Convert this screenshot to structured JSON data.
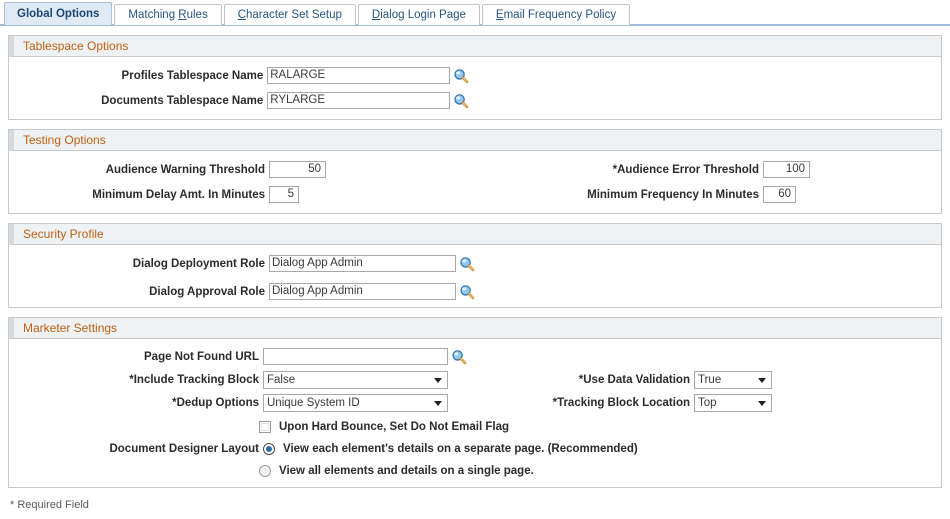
{
  "tabs": [
    {
      "label": "Global Options",
      "accel": "",
      "active": true
    },
    {
      "label": "Matching Rules",
      "accel": "R",
      "active": false
    },
    {
      "label": "Character Set Setup",
      "accel": "C",
      "active": false
    },
    {
      "label": "Dialog Login Page",
      "accel": "D",
      "active": false
    },
    {
      "label": "Email Frequency Policy",
      "accel": "E",
      "active": false
    }
  ],
  "sections": {
    "tablespace": {
      "title": "Tablespace Options",
      "profiles_label": "Profiles Tablespace Name",
      "profiles_value": "RALARGE",
      "documents_label": "Documents Tablespace Name",
      "documents_value": "RYLARGE",
      "lookup_icon": "magnifier-icon"
    },
    "testing": {
      "title": "Testing Options",
      "warning_label": "Audience Warning Threshold",
      "warning_value": "50",
      "error_label": "*Audience Error Threshold",
      "error_value": "100",
      "delay_label": "Minimum Delay Amt. In Minutes",
      "delay_value": "5",
      "frequency_label": "Minimum Frequency In Minutes",
      "frequency_value": "60"
    },
    "security": {
      "title": "Security Profile",
      "deployment_label": "Dialog Deployment Role",
      "deployment_value": "Dialog App Admin",
      "approval_label": "Dialog Approval Role",
      "approval_value": "Dialog App Admin"
    },
    "marketer": {
      "title": "Marketer Settings",
      "pagenotfound_label": "Page Not Found URL",
      "pagenotfound_value": "",
      "pagenotfound_placeholder": "",
      "tracking_label": "*Include Tracking Block",
      "tracking_value": "False",
      "dedup_label": "*Dedup Options",
      "dedup_value": "Unique System ID",
      "validation_label": "*Use Data Validation",
      "validation_value": "True",
      "tracking_loc_label": "*Tracking Block Location",
      "tracking_loc_value": "Top",
      "hardbounce_label": "Upon Hard Bounce, Set Do Not Email Flag",
      "hardbounce_checked": false,
      "layout_label": "Document Designer Layout",
      "layout_option_1": "View each element's details on a separate page. (Recommended)",
      "layout_option_2": "View all elements and details on a single page.",
      "layout_selected": 1
    }
  },
  "footer": {
    "required_note": "* Required Field"
  },
  "colors": {
    "section_title": "#c06010",
    "tab_text": "#27557f",
    "tab_active_bg": "#dfeaf5",
    "tabbar_rule": "#9fc0df",
    "radio_dot": "#2d6ca6"
  }
}
